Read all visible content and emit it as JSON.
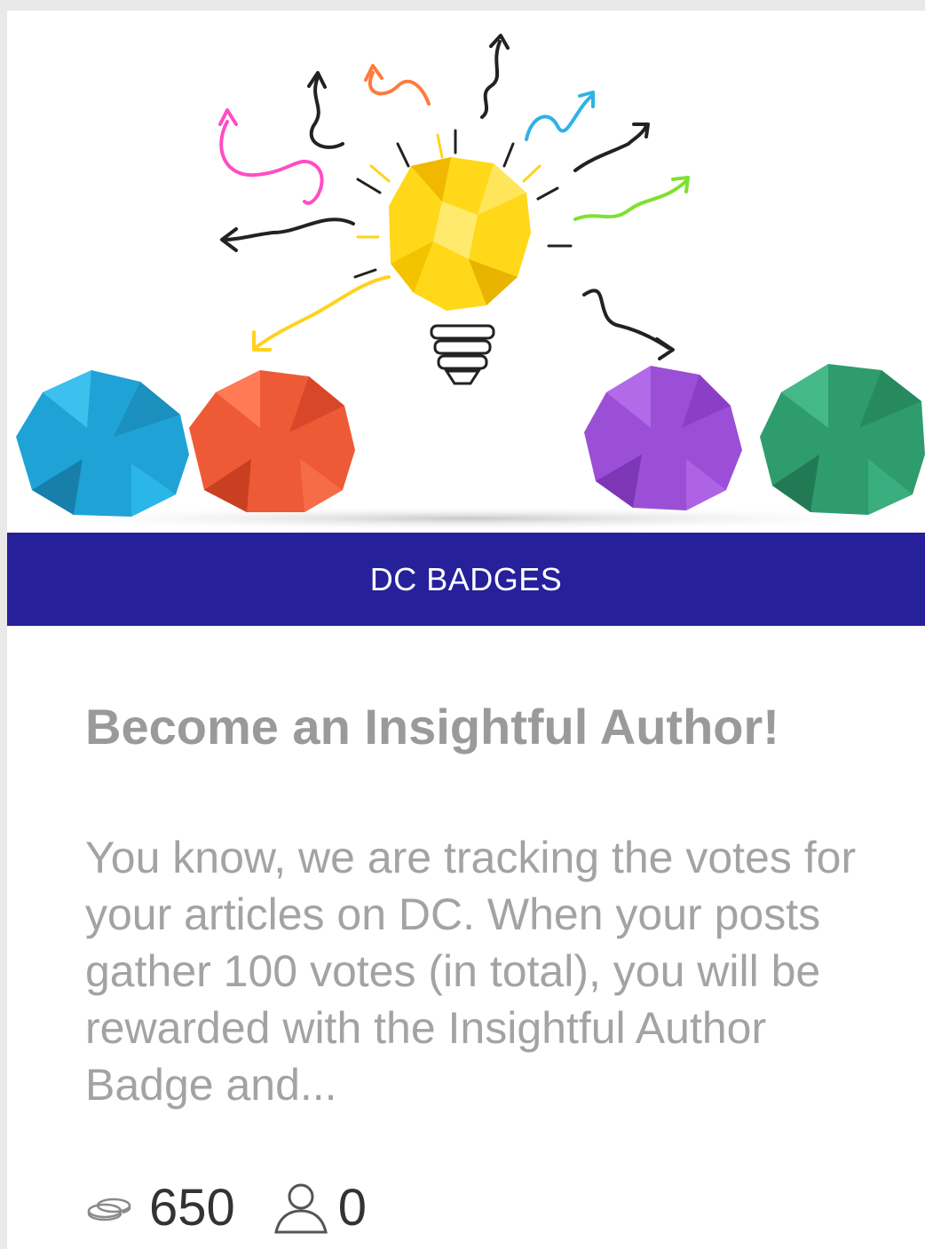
{
  "card": {
    "category": "DC  BADGES",
    "title": "Become an Insightful Author!",
    "excerpt": "You know, we are tracking the votes for your articles on DC. When your posts gather 100 votes (in total), you will be rewarded with the Insightful Author Badge and...",
    "stats": {
      "points": "650",
      "participants": "0",
      "points_icon": "coins-icon",
      "participants_icon": "user-icon"
    }
  },
  "colors": {
    "category_bar": "#26209a",
    "title": "#9a9a9a",
    "excerpt": "#a3a3a3",
    "stats_text": "#333333"
  }
}
